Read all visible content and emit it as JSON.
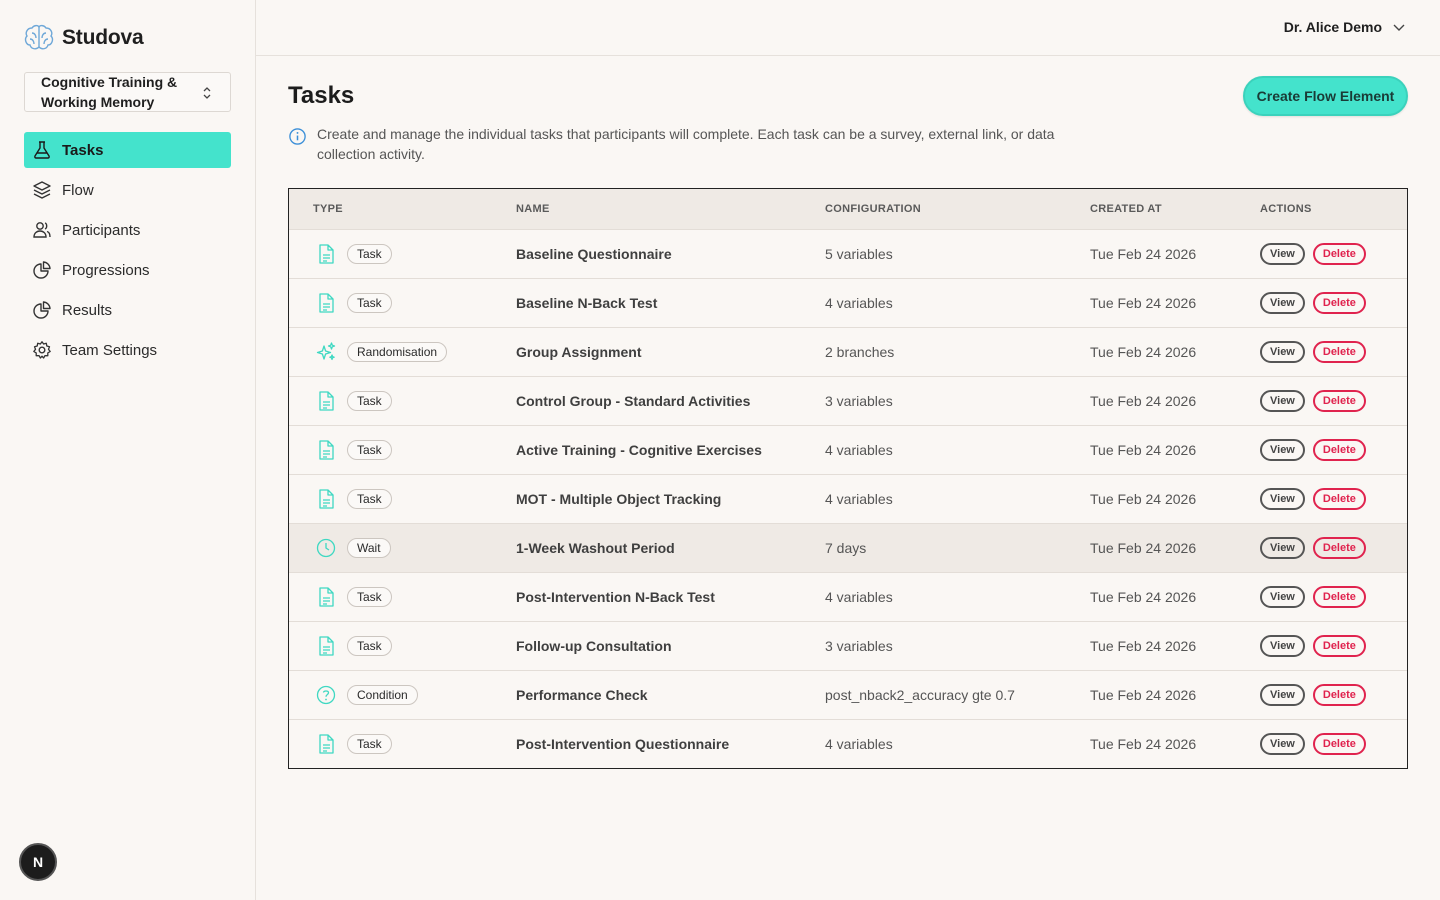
{
  "app": {
    "name": "Studova"
  },
  "study": {
    "name": "Cognitive Training & Working Memory"
  },
  "nav": [
    {
      "label": "Tasks",
      "icon": "flask-icon",
      "active": true
    },
    {
      "label": "Flow",
      "icon": "layers-icon"
    },
    {
      "label": "Participants",
      "icon": "users-icon"
    },
    {
      "label": "Progressions",
      "icon": "pie-chart-icon"
    },
    {
      "label": "Results",
      "icon": "pie-chart-icon"
    },
    {
      "label": "Team Settings",
      "icon": "gear-icon"
    }
  ],
  "user": {
    "name": "Dr. Alice Demo"
  },
  "page": {
    "title": "Tasks",
    "create_button": "Create Flow Element",
    "info_text": "Create and manage the individual tasks that participants will complete. Each task can be a survey, external link, or data collection activity."
  },
  "table": {
    "columns": {
      "type": "TYPE",
      "name": "NAME",
      "configuration": "CONFIGURATION",
      "created_at": "CREATED AT",
      "actions": "ACTIONS"
    },
    "view_label": "View",
    "delete_label": "Delete",
    "rows": [
      {
        "type": "Task",
        "icon": "document-icon",
        "name": "Baseline Questionnaire",
        "configuration": "5 variables",
        "created_at": "Tue Feb 24 2026"
      },
      {
        "type": "Task",
        "icon": "document-icon",
        "name": "Baseline N-Back Test",
        "configuration": "4 variables",
        "created_at": "Tue Feb 24 2026"
      },
      {
        "type": "Randomisation",
        "icon": "sparkles-icon",
        "name": "Group Assignment",
        "configuration": "2 branches",
        "created_at": "Tue Feb 24 2026"
      },
      {
        "type": "Task",
        "icon": "document-icon",
        "name": "Control Group - Standard Activities",
        "configuration": "3 variables",
        "created_at": "Tue Feb 24 2026"
      },
      {
        "type": "Task",
        "icon": "document-icon",
        "name": "Active Training - Cognitive Exercises",
        "configuration": "4 variables",
        "created_at": "Tue Feb 24 2026"
      },
      {
        "type": "Task",
        "icon": "document-icon",
        "name": "MOT - Multiple Object Tracking",
        "configuration": "4 variables",
        "created_at": "Tue Feb 24 2026"
      },
      {
        "type": "Wait",
        "icon": "clock-icon",
        "name": "1-Week Washout Period",
        "configuration": "7 days",
        "created_at": "Tue Feb 24 2026",
        "highlighted": true
      },
      {
        "type": "Task",
        "icon": "document-icon",
        "name": "Post-Intervention N-Back Test",
        "configuration": "4 variables",
        "created_at": "Tue Feb 24 2026"
      },
      {
        "type": "Task",
        "icon": "document-icon",
        "name": "Follow-up Consultation",
        "configuration": "3 variables",
        "created_at": "Tue Feb 24 2026"
      },
      {
        "type": "Condition",
        "icon": "question-circle-icon",
        "name": "Performance Check",
        "configuration": "post_nback2_accuracy gte 0.7",
        "created_at": "Tue Feb 24 2026"
      },
      {
        "type": "Task",
        "icon": "document-icon",
        "name": "Post-Intervention Questionnaire",
        "configuration": "4 variables",
        "created_at": "Tue Feb 24 2026"
      }
    ]
  },
  "dev_badge": "N",
  "colors": {
    "accent": "#44e3cc",
    "danger": "#e0234e",
    "icon": "#3fd8c2"
  }
}
